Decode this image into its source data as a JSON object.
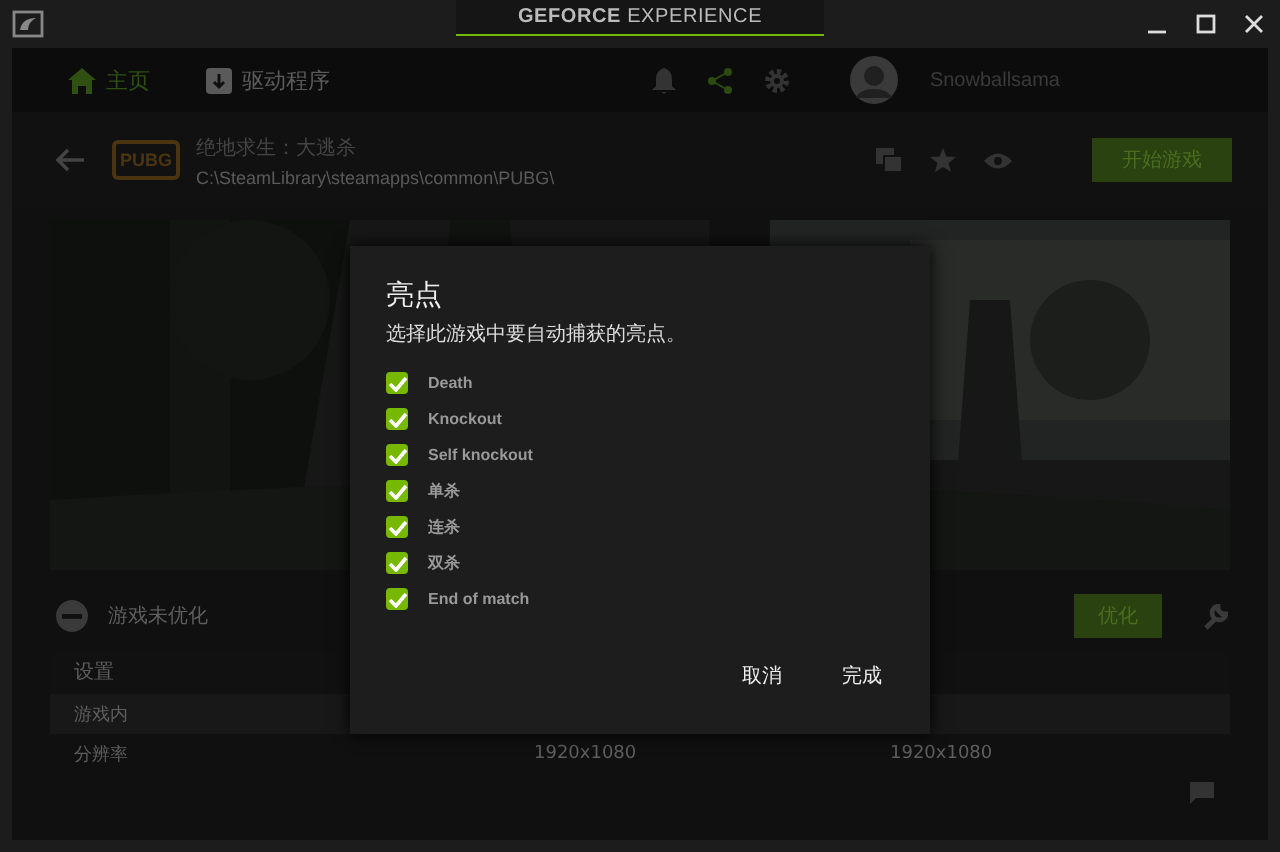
{
  "window": {
    "brand": "GEFORCE",
    "brand_suffix": "EXPERIENCE"
  },
  "nav": {
    "tabs": [
      {
        "label": "主页",
        "kind": "home",
        "selected": true
      },
      {
        "label": "驱动程序",
        "kind": "drivers",
        "selected": false
      }
    ],
    "user": "Snowballsama"
  },
  "game": {
    "logo": "PUBG",
    "title": "绝地求生：大逃杀",
    "path": "C:\\SteamLibrary\\steamapps\\common\\PUBG\\",
    "play_button": "开始游戏"
  },
  "optimization": {
    "status": "游戏未优化",
    "button": "优化"
  },
  "table": {
    "columns": [
      "设置"
    ],
    "rows": [
      {
        "kind": "section",
        "cells": [
          "游戏内"
        ]
      },
      {
        "kind": "setting",
        "cells": [
          "分辨率",
          "1920x1080",
          "1920x1080"
        ]
      }
    ]
  },
  "dialog": {
    "title": "亮点",
    "description": "选择此游戏中要自动捕获的亮点。",
    "options": [
      {
        "label": "Death",
        "checked": true
      },
      {
        "label": "Knockout",
        "checked": true
      },
      {
        "label": "Self knockout",
        "checked": true
      },
      {
        "label": "单杀",
        "checked": true
      },
      {
        "label": "连杀",
        "checked": true
      },
      {
        "label": "双杀",
        "checked": true
      },
      {
        "label": "End of match",
        "checked": true
      }
    ],
    "buttons": [
      "取消",
      "完成"
    ]
  }
}
